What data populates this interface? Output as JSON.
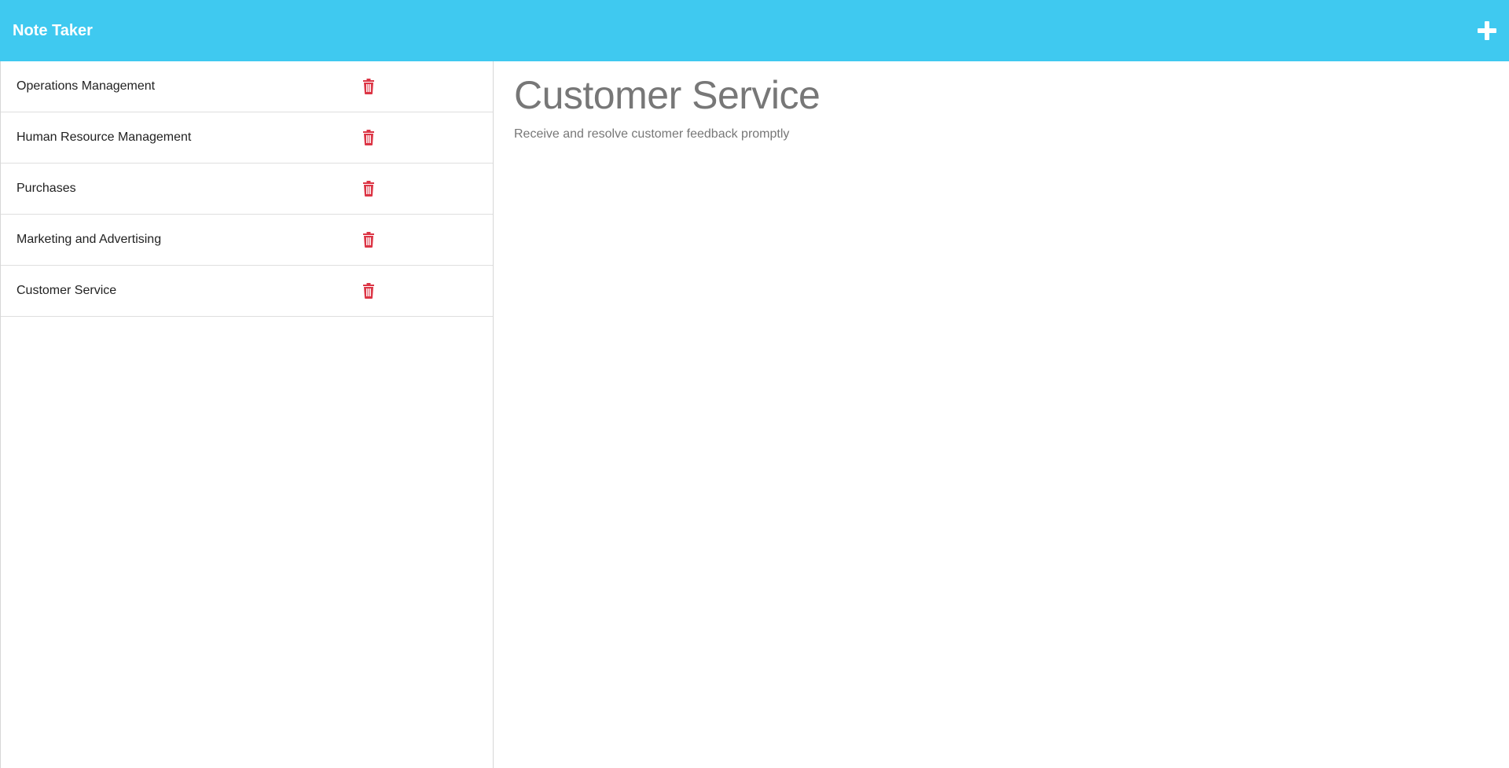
{
  "app": {
    "title": "Note Taker",
    "add_icon": "plus-icon",
    "accent_color": "#3fc9f0",
    "delete_color": "#dc3545"
  },
  "notes": [
    {
      "title": "Operations Management",
      "icon": "trash-icon"
    },
    {
      "title": "Human Resource Management",
      "icon": "trash-icon"
    },
    {
      "title": "Purchases",
      "icon": "trash-icon"
    },
    {
      "title": "Marketing and Advertising",
      "icon": "trash-icon"
    },
    {
      "title": "Customer Service",
      "icon": "trash-icon"
    }
  ],
  "active_note": {
    "title": "Customer Service",
    "text": "Receive and resolve customer feedback promptly"
  }
}
